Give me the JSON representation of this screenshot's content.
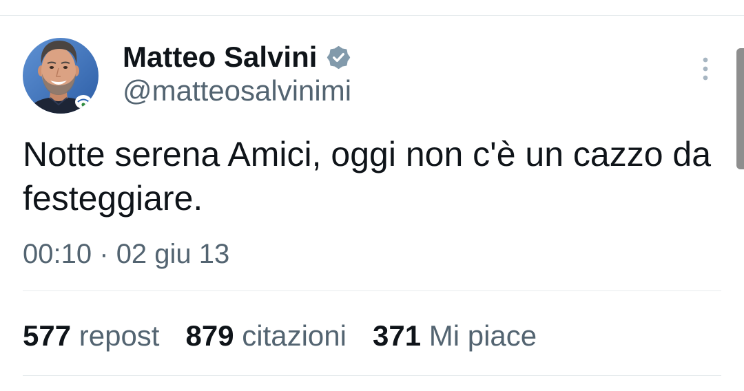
{
  "tweet": {
    "author": {
      "name": "Matteo Salvini",
      "handle": "@matteosalvinimi"
    },
    "text": "Notte serena Amici, oggi non c'è un cazzo da festeggiare.",
    "timestamp": {
      "time": "00:10",
      "separator": "·",
      "date": "02 giu 13"
    },
    "stats": [
      {
        "count": "577",
        "label": "repost"
      },
      {
        "count": "879",
        "label": "citazioni"
      },
      {
        "count": "371",
        "label": "Mi piace"
      }
    ]
  },
  "icons": {
    "verified": "verified-badge-icon",
    "more": "more-vertical-icon"
  },
  "colors": {
    "text_primary": "#0f1419",
    "text_secondary": "#536471",
    "divider": "#e7ecee",
    "verified_badge": "#829aab",
    "more_icon": "#a7b6c2",
    "scrollbar": "#8e8e8e"
  }
}
